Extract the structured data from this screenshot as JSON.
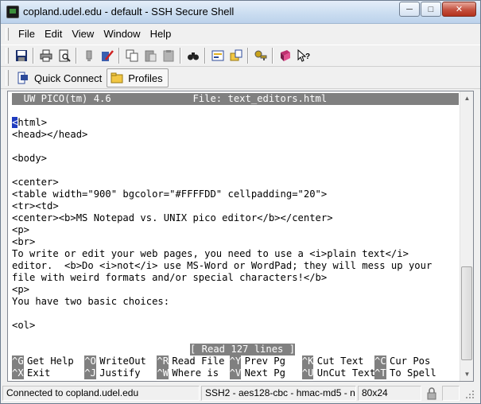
{
  "window": {
    "title": "copland.udel.edu - default - SSH Secure Shell"
  },
  "window_controls": {
    "minimize": "─",
    "maximize": "□",
    "close": "✕"
  },
  "menu": [
    "File",
    "Edit",
    "View",
    "Window",
    "Help"
  ],
  "toolbar": {
    "icons": [
      "save-icon",
      "print-icon",
      "print-preview-icon",
      "disconnect-icon",
      "edit-profile-icon",
      "copy-icon",
      "paste-icon",
      "paste-alt-icon",
      "find-icon",
      "settings-icon",
      "sftp-icon",
      "key-icon",
      "help-book-icon",
      "whats-this-icon"
    ]
  },
  "quickbar": {
    "quick_connect": "Quick Connect",
    "profiles": "Profiles"
  },
  "terminal": {
    "header": "  UW PICO(tm) 4.6              File: text_editors.html",
    "cursor_char": "<",
    "first_line_rest": "html>",
    "lines": [
      "<head></head>",
      "",
      "<body>",
      "",
      "<center>",
      "<table width=\"900\" bgcolor=\"#FFFFDD\" cellpadding=\"20\">",
      "<tr><td>",
      "<center><b>MS Notepad vs. UNIX pico editor</b></center>",
      "<p>",
      "<br>",
      "To write or edit your web pages, you need to use a <i>plain text</i>",
      "editor.  <b>Do <i>not</i> use MS-Word or WordPad; they will mess up your",
      "file with weird formats and/or special characters!</b>",
      "<p>",
      "You have two basic choices:",
      "",
      "<ol>"
    ],
    "status_message": "[ Read 127 lines ]",
    "shortcuts_row1": [
      {
        "key": "^G",
        "label": "Get Help"
      },
      {
        "key": "^O",
        "label": "WriteOut"
      },
      {
        "key": "^R",
        "label": "Read File"
      },
      {
        "key": "^Y",
        "label": "Prev Pg"
      },
      {
        "key": "^K",
        "label": "Cut Text"
      },
      {
        "key": "^C",
        "label": "Cur Pos"
      }
    ],
    "shortcuts_row2": [
      {
        "key": "^X",
        "label": "Exit"
      },
      {
        "key": "^J",
        "label": "Justify"
      },
      {
        "key": "^W",
        "label": "Where is"
      },
      {
        "key": "^V",
        "label": "Next Pg"
      },
      {
        "key": "^U",
        "label": "UnCut Text"
      },
      {
        "key": "^T",
        "label": "To Spell"
      }
    ]
  },
  "statusbar": {
    "connection": "Connected to copland.udel.edu",
    "cipher": "SSH2 - aes128-cbc - hmac-md5 - nc",
    "size": "80x24"
  }
}
